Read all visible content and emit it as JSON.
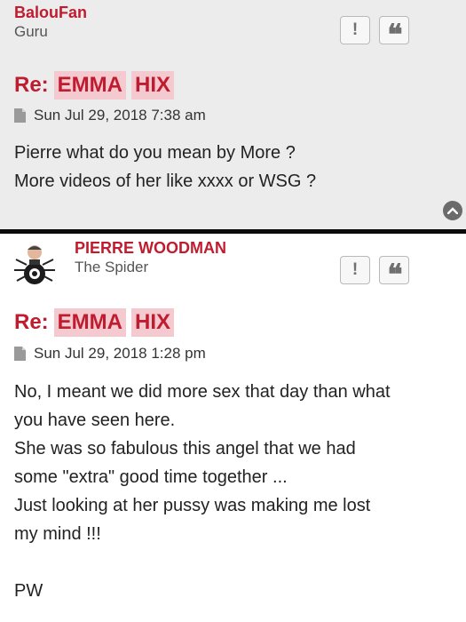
{
  "posts": [
    {
      "author": "BalouFan",
      "rank": "Guru",
      "report_label": "!",
      "quote_label": "66",
      "subject_prefix": "Re:",
      "subject_words": [
        "EMMA",
        "HIX"
      ],
      "date": "Sun Jul 29, 2018 7:38 am",
      "content_lines": [
        "Pierre what do you mean by More ?",
        "More videos of her like xxxx or WSG ?"
      ]
    },
    {
      "author": "PIERRE WOODMAN",
      "rank": "The Spider",
      "report_label": "!",
      "quote_label": "66",
      "subject_prefix": "Re:",
      "subject_words": [
        "EMMA",
        "HIX"
      ],
      "date": "Sun Jul 29, 2018 1:28 pm",
      "content_lines": [
        "No, I meant we did more sex that day than what",
        "you have seen here.",
        "She was so fabulous this angel that we had",
        "some \"extra\" good time together ...",
        "Just looking at her pussy was making me lost",
        "my mind !!!",
        "",
        "PW"
      ]
    }
  ],
  "icons": {
    "report": "exclamation-icon",
    "quote": "quote-icon",
    "post": "file-icon",
    "scroll": "chevron-up-icon"
  },
  "colors": {
    "author": "#c01c2f",
    "highlight": "#f4c9d0",
    "post_bg_alt": "#ececec"
  }
}
